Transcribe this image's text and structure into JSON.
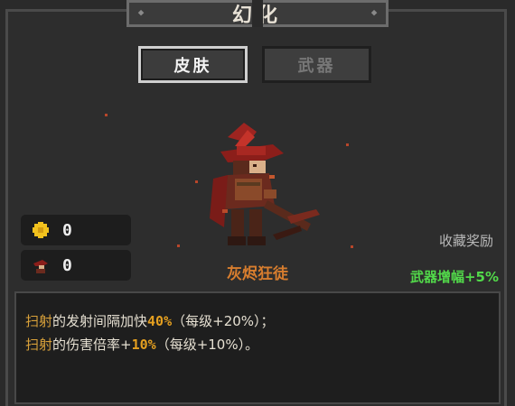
{
  "header": {
    "title": "幻化"
  },
  "tabs": [
    {
      "label": "皮肤",
      "active": true
    },
    {
      "label": "武器",
      "active": false
    }
  ],
  "character": {
    "name": "灰烬狂徒"
  },
  "stats": [
    {
      "icon": "gear-token-icon",
      "value": "0"
    },
    {
      "icon": "character-head-icon",
      "value": "0"
    }
  ],
  "rewards": {
    "collection_label": "收藏奖励",
    "weapon_boost_prefix": "武器增幅",
    "weapon_boost_value": "+5%"
  },
  "description": {
    "line1": {
      "lead": "扫射",
      "text1": "的发射间隔加快",
      "value": "40%",
      "text2": "（每级+20%）；"
    },
    "line2": {
      "lead": "扫射",
      "text1": "的伤害倍率+",
      "value": "10%",
      "text2": "（每级+10%）。"
    }
  },
  "colors": {
    "accent_orange": "#d77d2e",
    "boost_green": "#52d94a",
    "panel_bg": "#2d2d2d"
  }
}
